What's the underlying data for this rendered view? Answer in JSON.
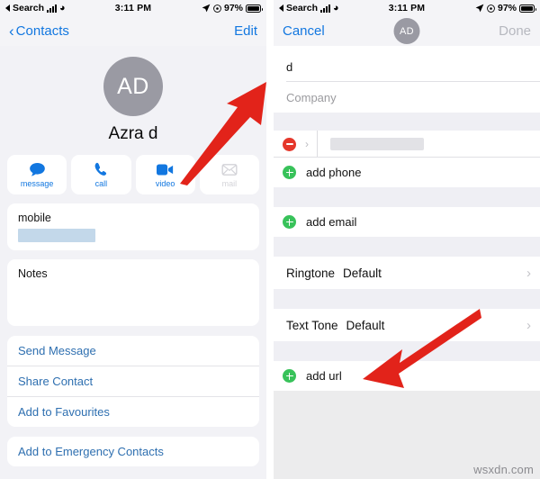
{
  "status_bar": {
    "carrier_label": "Search",
    "time": "3:11 PM",
    "battery_percent": "97%",
    "icons": [
      "back-triangle-icon",
      "signal-bars-icon",
      "wifi-icon",
      "location-arrow-icon",
      "alarm-icon",
      "battery-icon"
    ]
  },
  "left_screen": {
    "nav": {
      "back_label": "Contacts",
      "edit_label": "Edit"
    },
    "contact": {
      "initials": "AD",
      "name": "Azra d"
    },
    "actions": [
      {
        "label": "message",
        "icon": "message-bubble-icon",
        "enabled": true
      },
      {
        "label": "call",
        "icon": "phone-handset-icon",
        "enabled": true
      },
      {
        "label": "video",
        "icon": "video-camera-icon",
        "enabled": true
      },
      {
        "label": "mail",
        "icon": "envelope-icon",
        "enabled": false
      }
    ],
    "phone_card": {
      "label": "mobile",
      "value": ""
    },
    "notes_card": {
      "label": "Notes",
      "value": ""
    },
    "links": [
      "Send Message",
      "Share Contact",
      "Add to Favourites"
    ],
    "emergency_link": "Add to Emergency Contacts"
  },
  "right_screen": {
    "nav": {
      "cancel_label": "Cancel",
      "done_label": "Done",
      "initials": "AD"
    },
    "fields": {
      "last_name_value": "d",
      "company_placeholder": "Company"
    },
    "phone_entry": {
      "delete_icon": "minus-circle-icon",
      "expand_icon": "chevron-right-icon",
      "value": ""
    },
    "add_phone_label": "add phone",
    "add_email_label": "add email",
    "ringtone": {
      "label": "Ringtone",
      "value": "Default"
    },
    "text_tone": {
      "label": "Text Tone",
      "value": "Default"
    },
    "add_url_label": "add url"
  },
  "annotations": {
    "arrow_color": "#E2231A",
    "left_arrow_target": "Edit",
    "right_arrow_target": "Ringtone Default"
  },
  "watermark": "wsxdn.com",
  "theme": {
    "accent_blue": "#1277e0",
    "link_blue": "#2e6fb0",
    "avatar_grey": "#9a9aa3",
    "delete_red": "#e5372b",
    "add_green": "#38c25a",
    "page_bg": "#f2f2f6"
  }
}
